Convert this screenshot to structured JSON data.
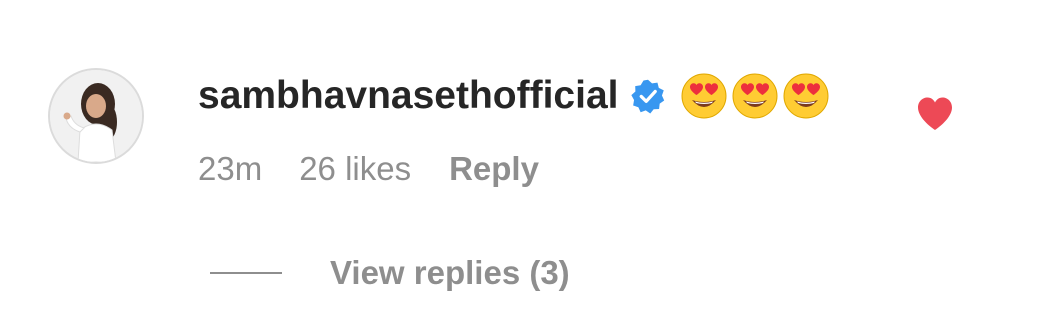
{
  "comment": {
    "username": "sambhavnasethofficial",
    "verified_icon": "verified-badge-icon",
    "emojis": [
      "😍",
      "😍",
      "😍"
    ],
    "time": "23m",
    "likes": "26 likes",
    "reply_label": "Reply",
    "liked": true,
    "like_color": "#ed4956"
  },
  "replies": {
    "label": "View replies (3)"
  },
  "colors": {
    "text_primary": "#262626",
    "text_secondary": "#8e8e8e",
    "verified_blue": "#3897f0",
    "heart_red": "#ed4956"
  }
}
